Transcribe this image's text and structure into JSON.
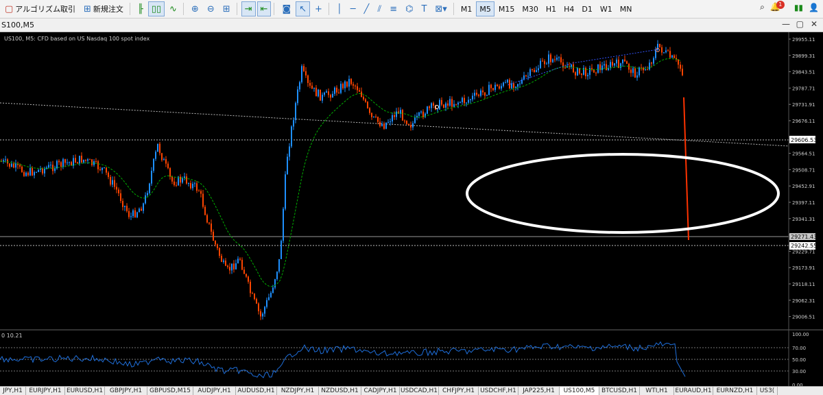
{
  "toolbar": {
    "algo_label": "アルゴリズム取引",
    "new_order_label": "新規注文",
    "timeframes": [
      "M1",
      "M5",
      "M15",
      "M30",
      "H1",
      "H4",
      "D1",
      "W1",
      "MN"
    ],
    "active_timeframe": "M5",
    "notification_count": "1"
  },
  "window": {
    "title": "S100,M5",
    "min": "—",
    "restore": "▢",
    "close": "✕"
  },
  "chart": {
    "info": "US100, M5:  CFD based on US Nasdaq 100 spot index",
    "price_ticks": [
      "29955.11",
      "29899.31",
      "29843.51",
      "29787.71",
      "29731.91",
      "29676.11",
      "29620.31",
      "29564.51",
      "29508.71",
      "29452.91",
      "29397.11",
      "29341.31",
      "29285.51",
      "29229.71",
      "29173.91",
      "29118.11",
      "29062.31",
      "29006.51"
    ],
    "level_high": "29606.53",
    "level_current": "29271.43",
    "level_low": "29242.55",
    "indicator_label": "0 10.21",
    "ind_ticks": [
      "100.00",
      "70.00",
      "50.00",
      "30.00",
      "0.00"
    ]
  },
  "colors": {
    "bull": "#1e90ff",
    "bear": "#ff4500",
    "ma": "#00c000",
    "annotation": "#ffffff",
    "indicator": "#1e6fdc"
  },
  "tabs": [
    "JPY,H1",
    "EURJPY,H1",
    "EURUSD,H1",
    "GBPJPY,H1",
    "GBPUSD,M15",
    "AUDJPY,H1",
    "AUDUSD,H1",
    "NZDJPY,H1",
    "NZDUSD,H1",
    "CADJPY,H1",
    "USDCAD,H1",
    "CHFJPY,H1",
    "USDCHF,H1",
    "JAP225,H1",
    "US100,M5",
    "BTCUSD,H1",
    "WTI,H1",
    "EURAUD,H1",
    "EURNZD,H1",
    "US3("
  ],
  "active_tab": "US100,M5"
}
